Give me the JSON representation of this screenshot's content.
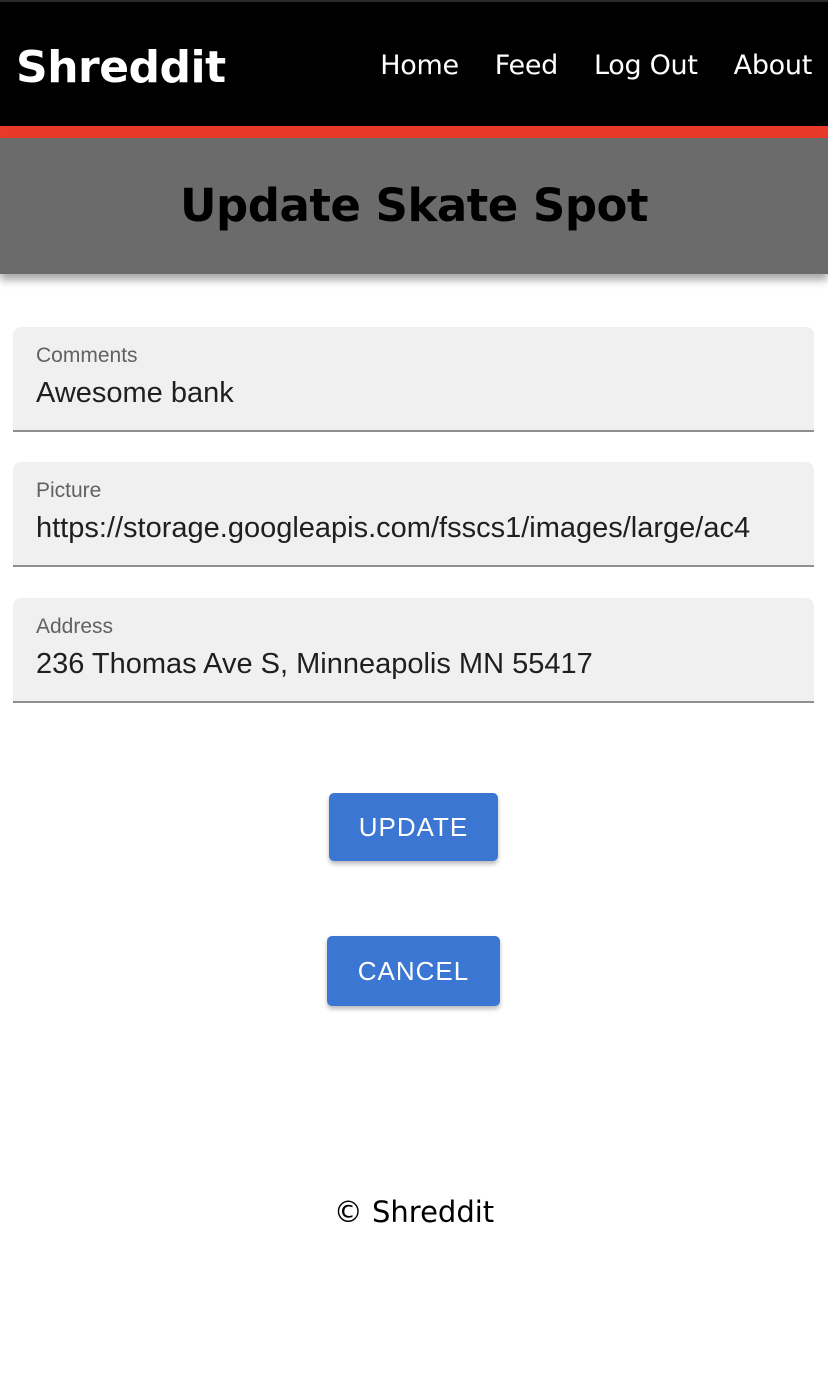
{
  "navbar": {
    "brand": "Shreddit",
    "links": [
      "Home",
      "Feed",
      "Log Out",
      "About"
    ]
  },
  "header": {
    "title": "Update Skate Spot"
  },
  "form": {
    "fields": [
      {
        "label": "Comments",
        "value": "Awesome bank"
      },
      {
        "label": "Picture",
        "value": "https://storage.googleapis.com/fsscs1/images/large/ac4"
      },
      {
        "label": "Address",
        "value": "236 Thomas Ave S, Minneapolis MN 55417"
      }
    ],
    "update_label": "UPDATE",
    "cancel_label": "CANCEL"
  },
  "footer": {
    "text": "© Shreddit"
  },
  "colors": {
    "navbar_bg": "#000000",
    "accent": "#e8392a",
    "banner_bg": "#6b6b6b",
    "button": "#3a76d2"
  }
}
